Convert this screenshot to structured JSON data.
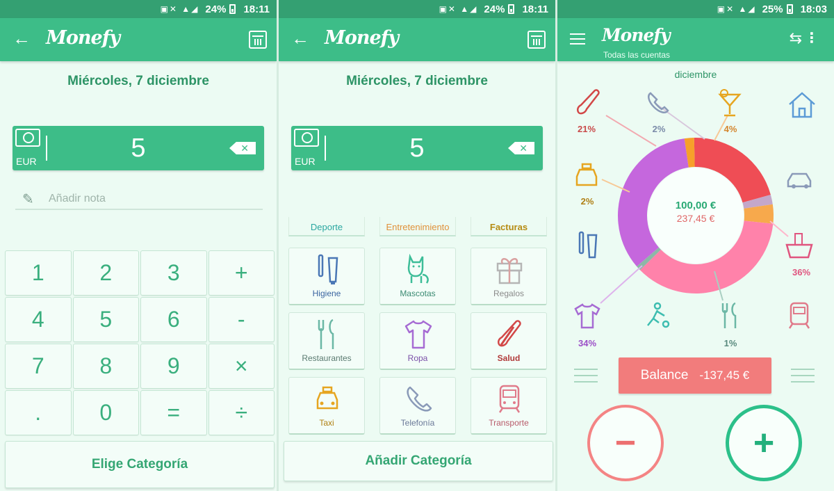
{
  "screens": [
    {
      "status": {
        "battery": "24%",
        "time": "18:11"
      },
      "app_title": "Monefy",
      "date": "Miércoles, 7 diciembre",
      "amount": {
        "currency": "EUR",
        "value": "5"
      },
      "note_placeholder": "Añadir nota",
      "keypad": [
        "1",
        "2",
        "3",
        "+",
        "4",
        "5",
        "6",
        "-",
        "7",
        "8",
        "9",
        "×",
        ".",
        "0",
        "=",
        "÷"
      ],
      "action_button": "Elige Categoría"
    },
    {
      "status": {
        "battery": "24%",
        "time": "18:11"
      },
      "app_title": "Monefy",
      "date": "Miércoles, 7 diciembre",
      "amount": {
        "currency": "EUR",
        "value": "5"
      },
      "top_categories": [
        {
          "label": "Deporte",
          "color": "#2aa7a0"
        },
        {
          "label": "Entretenimiento",
          "color": "#e0913a"
        },
        {
          "label": "Facturas",
          "color": "#c79a1e"
        }
      ],
      "categories": [
        {
          "label": "Higiene",
          "icon": "toothbrush-icon",
          "color": "#4a77b5"
        },
        {
          "label": "Mascotas",
          "icon": "cat-icon",
          "color": "#3dbd98"
        },
        {
          "label": "Regalos",
          "icon": "gift-icon",
          "color": "#b5b5b5"
        },
        {
          "label": "Restaurantes",
          "icon": "cutlery-icon",
          "color": "#6bb7a5"
        },
        {
          "label": "Ropa",
          "icon": "tshirt-icon",
          "color": "#a66bd3"
        },
        {
          "label": "Salud",
          "icon": "thermometer-icon",
          "color": "#d24747"
        },
        {
          "label": "Taxi",
          "icon": "taxi-icon",
          "color": "#e6a520"
        },
        {
          "label": "Telefonía",
          "icon": "phone-icon",
          "color": "#8a9ab8"
        },
        {
          "label": "Transporte",
          "icon": "train-icon",
          "color": "#e07a8a"
        }
      ],
      "action_button": "Añadir Categoría"
    },
    {
      "status": {
        "battery": "25%",
        "time": "18:03"
      },
      "app_title": "Monefy",
      "subtitle": "Todas las cuentas",
      "month": "diciembre",
      "income_total": "100,00 €",
      "expense_total": "237,45 €",
      "percent_labels": [
        {
          "text": "21%",
          "icon": "thermometer-icon",
          "color": "#c94b4b"
        },
        {
          "text": "2%",
          "icon": "phone-icon",
          "color": "#7a8aa8"
        },
        {
          "text": "4%",
          "icon": "cocktail-icon",
          "color": "#e0913a"
        },
        {
          "text": "2%",
          "icon": "taxi-icon",
          "color": "#e6a520"
        },
        {
          "text": "36%",
          "icon": "basket-icon",
          "color": "#e0557f"
        },
        {
          "text": "34%",
          "icon": "tshirt-icon",
          "color": "#9b4fc7"
        },
        {
          "text": "1%",
          "icon": "cutlery-icon",
          "color": "#6bb7a5"
        }
      ],
      "balance": {
        "label": "Balance",
        "value": "-137,45 €"
      },
      "buttons": {
        "minus": "−",
        "plus": "+"
      },
      "colors": {
        "income": "#2aa974",
        "expense": "#e06767"
      }
    }
  ],
  "chart_data": {
    "type": "pie",
    "title": "",
    "slices": [
      {
        "label": "Salud",
        "value": 21,
        "color": "#ef4d55"
      },
      {
        "label": "Telefonía",
        "value": 2,
        "color": "#c4a7c9"
      },
      {
        "label": "Bebidas",
        "value": 4,
        "color": "#f7a94c"
      },
      {
        "label": "Compras",
        "value": 36,
        "color": "#ff82aa"
      },
      {
        "label": "Restaurantes",
        "value": 1,
        "color": "#8db7a7"
      },
      {
        "label": "Ropa",
        "value": 34,
        "color": "#c567dd"
      },
      {
        "label": "Taxi",
        "value": 2,
        "color": "#f7a02a"
      }
    ]
  }
}
